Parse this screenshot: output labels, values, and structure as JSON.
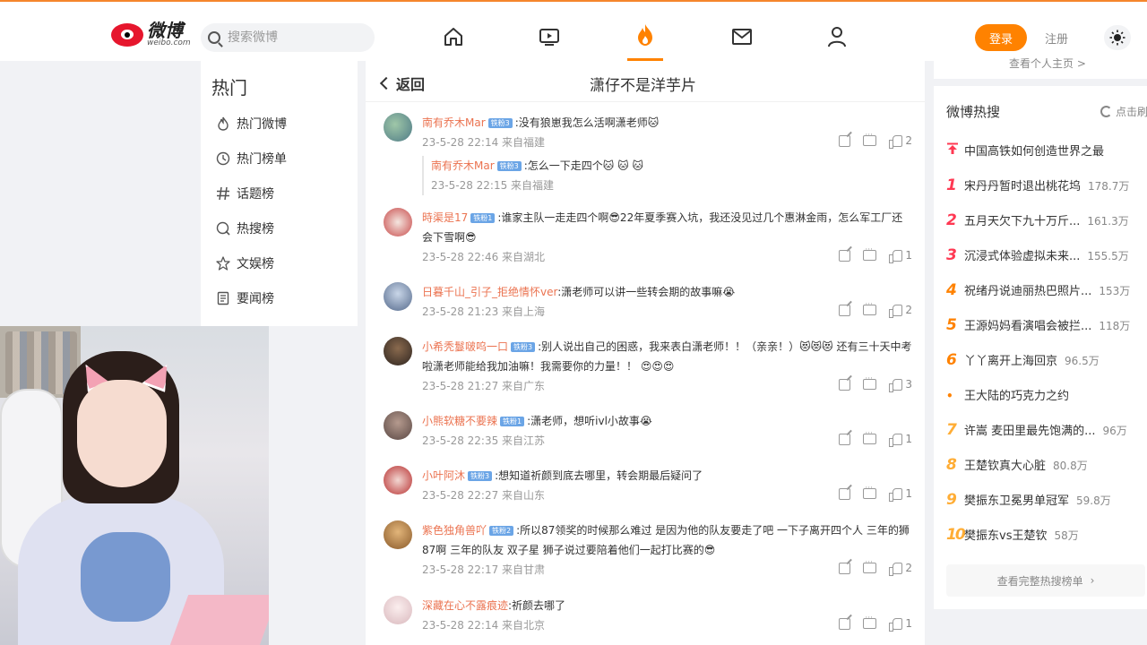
{
  "header": {
    "logo_cn": "微博",
    "logo_en": "weibo.com",
    "search_placeholder": "搜索微博",
    "login_label": "登录",
    "register_label": "注册",
    "accent": "#ff8200"
  },
  "sidebar": {
    "title": "热门",
    "items": [
      {
        "label": "热门微博",
        "icon": "flame-outline-icon"
      },
      {
        "label": "热门榜单",
        "icon": "clock-icon"
      },
      {
        "label": "话题榜",
        "icon": "hashtag-icon"
      },
      {
        "label": "热搜榜",
        "icon": "search-circle-icon"
      },
      {
        "label": "文娱榜",
        "icon": "star-icon"
      },
      {
        "label": "要闻榜",
        "icon": "document-icon"
      }
    ]
  },
  "main": {
    "back_label": "返回",
    "title": "潇仔不是洋芋片",
    "comments": [
      {
        "user": "南有乔木Mar",
        "badge": "铁粉3",
        "text": ":没有狼崽我怎么活啊潇老师🐱",
        "meta": "23-5-28 22:14 来自福建",
        "likes": "2",
        "reply": {
          "user": "南有乔木Mar",
          "badge": "铁粉3",
          "text": ":怎么一下走四个🐱 🐱 🐱",
          "meta": "23-5-28 22:15 来自福建"
        }
      },
      {
        "user": "時渠是17",
        "badge": "铁粉1",
        "text": ":谁家主队一走走四个啊😎22年夏季赛入坑，我还没见过几个惠淋金雨，怎么军工厂还会下雪啊😎",
        "meta": "23-5-28 22:46 来自湖北",
        "likes": "1"
      },
      {
        "user": "日暮千山_引子_拒绝情怀ver",
        "badge": "",
        "text": ":潇老师可以讲一些转会期的故事嘛😭",
        "meta": "23-5-28 21:23 来自上海",
        "likes": "2"
      },
      {
        "user": "小希秃鬘啵呜一口",
        "badge": "铁粉3",
        "text": ":别人说出自己的困惑，我来表白潇老师！！（亲亲！）😻😻😻 还有三十天中考啦潇老师能给我加油嘛！我需要你的力量！！ 😍😍😍",
        "meta": "23-5-28 21:27 来自广东",
        "likes": "3"
      },
      {
        "user": "小熊软糖不要辣",
        "badge": "铁粉1",
        "text": ":潇老师，想听ivl小故事😭",
        "meta": "23-5-28 22:35 来自江苏",
        "likes": "1"
      },
      {
        "user": "小叶阿沐",
        "badge": "铁粉3",
        "text": ":想知道祈颜到底去哪里，转会期最后疑问了",
        "meta": "23-5-28 22:27 来自山东",
        "likes": "1"
      },
      {
        "user": "紫色独角兽吖",
        "badge": "铁粉2",
        "text": ":所以87领奖的时候那么难过 是因为他的队友要走了吧 一下子离开四个人 三年的狮87啊 三年的队友 双子星 狮子说过要陪着他们一起打比赛的😎",
        "meta": "23-5-28 22:17 来自甘肃",
        "likes": "2"
      },
      {
        "user": "深藏在心不露痕迹",
        "badge": "",
        "text": ":祈颜去哪了",
        "meta": "23-5-28 22:14 来自北京",
        "likes": "1"
      }
    ]
  },
  "right": {
    "top_link": "查看个人主页 >",
    "title": "微博热搜",
    "refresh_label": "点击刷新",
    "pinned": "中国高铁如何创造世界之最",
    "items": [
      {
        "rank": "1",
        "title": "宋丹丹暂时退出桃花坞",
        "heat": "178.7万"
      },
      {
        "rank": "2",
        "title": "五月天欠下九十万斤...",
        "heat": "161.3万"
      },
      {
        "rank": "3",
        "title": "沉浸式体验虚拟未来...",
        "heat": "155.5万"
      },
      {
        "rank": "4",
        "title": "祝绪丹说迪丽热巴照片...",
        "heat": "153万"
      },
      {
        "rank": "5",
        "title": "王源妈妈看演唱会被拦...",
        "heat": "118万"
      },
      {
        "rank": "6",
        "title": "丫丫离开上海回京",
        "heat": "96.5万"
      },
      {
        "rank": "•",
        "title": "王大陆的巧克力之约",
        "heat": ""
      },
      {
        "rank": "7",
        "title": "许嵩 麦田里最先饱满的...",
        "heat": "96万"
      },
      {
        "rank": "8",
        "title": "王楚钦真大心脏",
        "heat": "80.8万"
      },
      {
        "rank": "9",
        "title": "樊振东卫冕男单冠军",
        "heat": "59.8万"
      },
      {
        "rank": "10",
        "title": "樊振东vs王楚钦",
        "heat": "58万"
      }
    ],
    "more_label": "查看完整热搜榜单",
    "rank_colors": {
      "top": "#ff3852",
      "mid": "#ff8200",
      "low": "#ffad35"
    }
  }
}
